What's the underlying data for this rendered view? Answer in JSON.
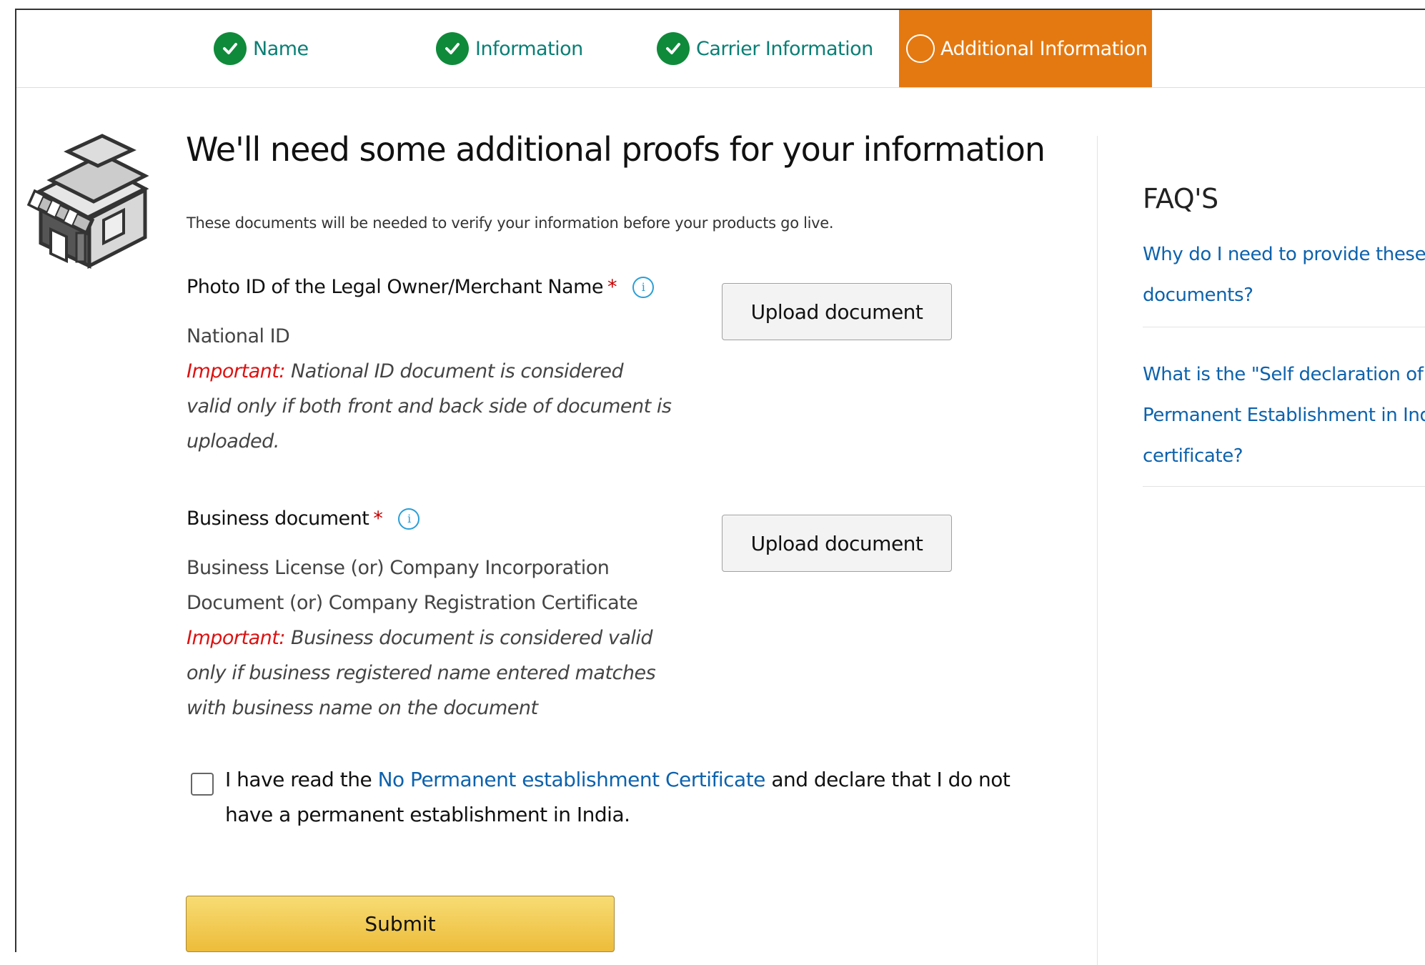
{
  "stepper": {
    "steps": [
      {
        "label": "Name",
        "status": "complete"
      },
      {
        "label": "Information",
        "status": "complete"
      },
      {
        "label": "Carrier Information",
        "status": "complete"
      },
      {
        "label": "Additional Information",
        "status": "current"
      }
    ]
  },
  "main": {
    "title": "We'll need some additional proofs for your information",
    "subtitle": "These documents will be needed to verify your information before your products go live.",
    "photo_id": {
      "label": "Photo ID of the Legal Owner/Merchant Name",
      "required_mark": "*",
      "doc_type": "National ID",
      "important_prefix": "Important:",
      "important_text": "National ID document is considered valid only if both front and back side of document is uploaded.",
      "upload_label": "Upload document"
    },
    "business_doc": {
      "label": "Business document",
      "required_mark": "*",
      "doc_type_line1": "Business License (or) Company Incorporation",
      "doc_type_line2": "Document (or) Company Registration Certificate",
      "important_prefix": "Important:",
      "important_text": "Business document is considered valid only if business registered name entered matches with business name on the document",
      "upload_label": "Upload document"
    },
    "declaration": {
      "prefix": "I have read the",
      "link": "No Permanent establishment Certificate",
      "suffix": "and declare that I do not have a permanent establishment in India.",
      "checked": false
    },
    "submit_label": "Submit"
  },
  "faq": {
    "title": "FAQ'S",
    "items": [
      {
        "line1": "Why do I need to provide these",
        "line2": "documents?"
      },
      {
        "line1": "What is the \"Self declaration of no",
        "line2": "Permanent Establishment in India\"",
        "line3": "certificate?"
      }
    ]
  },
  "colors": {
    "accent_orange": "#e47911",
    "check_green": "#0f8a3a",
    "link_blue": "#0d62ad",
    "important_red": "#d11111"
  }
}
